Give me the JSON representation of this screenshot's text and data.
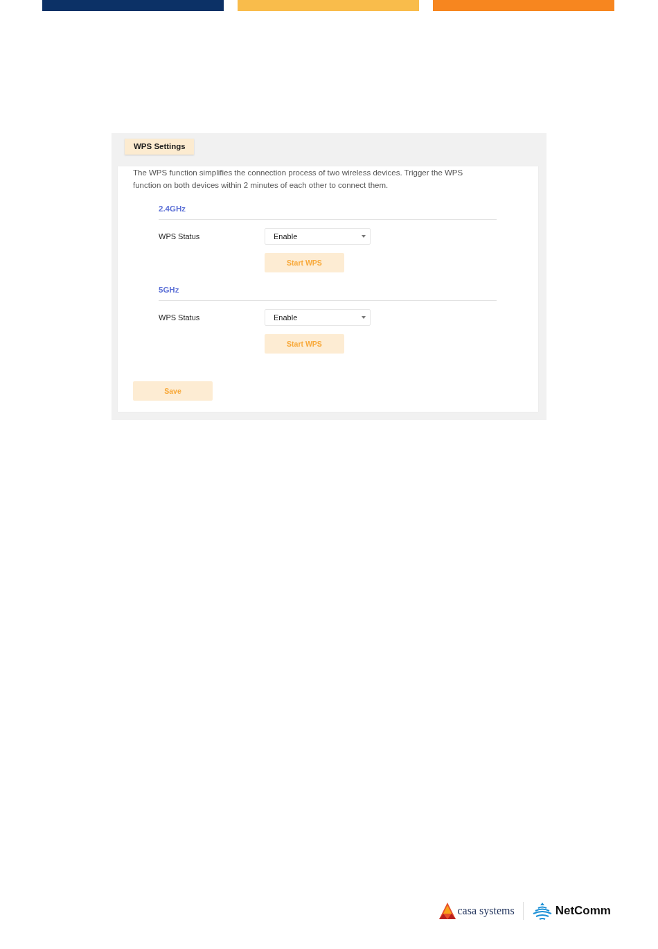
{
  "header_bars": [
    {
      "color": "#0c3166"
    },
    {
      "color": "#f9bc4b"
    },
    {
      "color": "#f7861f"
    }
  ],
  "panel": {
    "tab": "WPS Settings",
    "description": "The WPS function simplifies the connection process of two wireless devices. Trigger the WPS function on both devices within 2 minutes of each other to connect them.",
    "bands": [
      {
        "title": "2.4GHz",
        "field_label": "WPS Status",
        "value": "Enable",
        "button": "Start WPS"
      },
      {
        "title": "5GHz",
        "field_label": "WPS Status",
        "value": "Enable",
        "button": "Start WPS"
      }
    ],
    "save_button": "Save"
  },
  "footer": {
    "casa_logo": "casa systems",
    "netcomm_logo": "NetComm"
  }
}
